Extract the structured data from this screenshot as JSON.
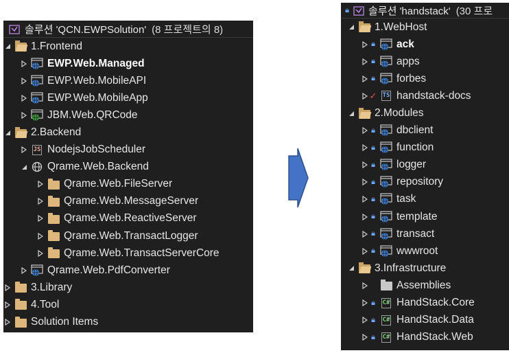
{
  "left": {
    "header": {
      "title": "솔루션 'QCN.EWPSolution'",
      "count": "(8 프로젝트의 8)"
    },
    "items": [
      {
        "label": "1.Frontend",
        "icon": "folder-open-icon",
        "indent": 0,
        "arrow": "expanded",
        "bold": false
      },
      {
        "label": "EWP.Web.Managed",
        "icon": "web-project-icon",
        "indent": 1,
        "arrow": "collapsed",
        "bold": true
      },
      {
        "label": "EWP.Web.MobileAPI",
        "icon": "web-project-icon",
        "indent": 1,
        "arrow": "collapsed",
        "bold": false
      },
      {
        "label": "EWP.Web.MobileApp",
        "icon": "web-project-icon",
        "indent": 1,
        "arrow": "collapsed",
        "bold": false
      },
      {
        "label": "JBM.Web.QRCode",
        "icon": "web-project-green-icon",
        "indent": 1,
        "arrow": "collapsed",
        "bold": false
      },
      {
        "label": "2.Backend",
        "icon": "folder-open-icon",
        "indent": 0,
        "arrow": "expanded",
        "bold": false
      },
      {
        "label": "NodejsJobScheduler",
        "icon": "js-file-icon",
        "indent": 1,
        "arrow": "collapsed",
        "bold": false
      },
      {
        "label": "Qrame.Web.Backend",
        "icon": "globe-icon",
        "indent": 1,
        "arrow": "expanded",
        "bold": false
      },
      {
        "label": "Qrame.Web.FileServer",
        "icon": "folder-icon",
        "indent": 2,
        "arrow": "collapsed",
        "bold": false
      },
      {
        "label": "Qrame.Web.MessageServer",
        "icon": "folder-icon",
        "indent": 2,
        "arrow": "collapsed",
        "bold": false
      },
      {
        "label": "Qrame.Web.ReactiveServer",
        "icon": "folder-icon",
        "indent": 2,
        "arrow": "collapsed",
        "bold": false
      },
      {
        "label": "Qrame.Web.TransactLogger",
        "icon": "folder-icon",
        "indent": 2,
        "arrow": "collapsed",
        "bold": false
      },
      {
        "label": "Qrame.Web.TransactServerCore",
        "icon": "folder-icon",
        "indent": 2,
        "arrow": "collapsed",
        "bold": false
      },
      {
        "label": "Qrame.Web.PdfConverter",
        "icon": "web-project-icon",
        "indent": 1,
        "arrow": "collapsed",
        "bold": false
      },
      {
        "label": "3.Library",
        "icon": "folder-icon",
        "indent": 0,
        "arrow": "collapsed",
        "bold": false
      },
      {
        "label": "4.Tool",
        "icon": "folder-icon",
        "indent": 0,
        "arrow": "collapsed",
        "bold": false
      },
      {
        "label": "Solution Items",
        "icon": "folder-icon",
        "indent": 0,
        "arrow": "collapsed",
        "bold": false
      }
    ]
  },
  "right": {
    "header": {
      "title": "솔루션 'handstack'",
      "count": "(30 프로"
    },
    "items": [
      {
        "label": "1.WebHost",
        "icon": "folder-open-icon",
        "indent": 0,
        "arrow": "expanded",
        "lock": false,
        "check": false,
        "bold": false
      },
      {
        "label": "ack",
        "icon": "web-project-icon",
        "indent": 1,
        "arrow": "collapsed",
        "lock": true,
        "check": false,
        "bold": true
      },
      {
        "label": "apps",
        "icon": "web-project-icon",
        "indent": 1,
        "arrow": "collapsed",
        "lock": true,
        "check": false,
        "bold": false
      },
      {
        "label": "forbes",
        "icon": "web-project-icon",
        "indent": 1,
        "arrow": "collapsed",
        "lock": true,
        "check": false,
        "bold": false
      },
      {
        "label": "handstack-docs",
        "icon": "ts-project-icon",
        "indent": 1,
        "arrow": "collapsed",
        "lock": false,
        "check": true,
        "bold": false
      },
      {
        "label": "2.Modules",
        "icon": "folder-open-icon",
        "indent": 0,
        "arrow": "expanded",
        "lock": false,
        "check": false,
        "bold": false
      },
      {
        "label": "dbclient",
        "icon": "web-project-icon",
        "indent": 1,
        "arrow": "collapsed",
        "lock": true,
        "check": false,
        "bold": false
      },
      {
        "label": "function",
        "icon": "web-project-icon",
        "indent": 1,
        "arrow": "collapsed",
        "lock": true,
        "check": false,
        "bold": false
      },
      {
        "label": "logger",
        "icon": "web-project-icon",
        "indent": 1,
        "arrow": "collapsed",
        "lock": true,
        "check": false,
        "bold": false
      },
      {
        "label": "repository",
        "icon": "web-project-icon",
        "indent": 1,
        "arrow": "collapsed",
        "lock": true,
        "check": false,
        "bold": false
      },
      {
        "label": "task",
        "icon": "web-project-icon",
        "indent": 1,
        "arrow": "collapsed",
        "lock": true,
        "check": false,
        "bold": false
      },
      {
        "label": "template",
        "icon": "web-project-icon",
        "indent": 1,
        "arrow": "collapsed",
        "lock": true,
        "check": false,
        "bold": false
      },
      {
        "label": "transact",
        "icon": "web-project-icon",
        "indent": 1,
        "arrow": "collapsed",
        "lock": true,
        "check": false,
        "bold": false
      },
      {
        "label": "wwwroot",
        "icon": "web-project-icon",
        "indent": 1,
        "arrow": "collapsed",
        "lock": true,
        "check": false,
        "bold": false
      },
      {
        "label": "3.Infrastructure",
        "icon": "folder-open-icon",
        "indent": 0,
        "arrow": "expanded",
        "lock": false,
        "check": false,
        "bold": false
      },
      {
        "label": "Assemblies",
        "icon": "folder-gray-icon",
        "indent": 1,
        "arrow": "collapsed",
        "lock": false,
        "check": false,
        "bold": false
      },
      {
        "label": "HandStack.Core",
        "icon": "csharp-project-icon",
        "indent": 1,
        "arrow": "collapsed",
        "lock": true,
        "check": false,
        "bold": false
      },
      {
        "label": "HandStack.Data",
        "icon": "csharp-project-icon",
        "indent": 1,
        "arrow": "collapsed",
        "lock": true,
        "check": false,
        "bold": false
      },
      {
        "label": "HandStack.Web",
        "icon": "csharp-project-icon",
        "indent": 1,
        "arrow": "collapsed",
        "lock": true,
        "check": false,
        "bold": false
      }
    ]
  },
  "colors": {
    "panel": "#1f1f1f",
    "text": "#e6e6e6",
    "folder": "#dcb67a",
    "arrow_fill": "#4472c4",
    "lock": "#6aa7ff"
  }
}
